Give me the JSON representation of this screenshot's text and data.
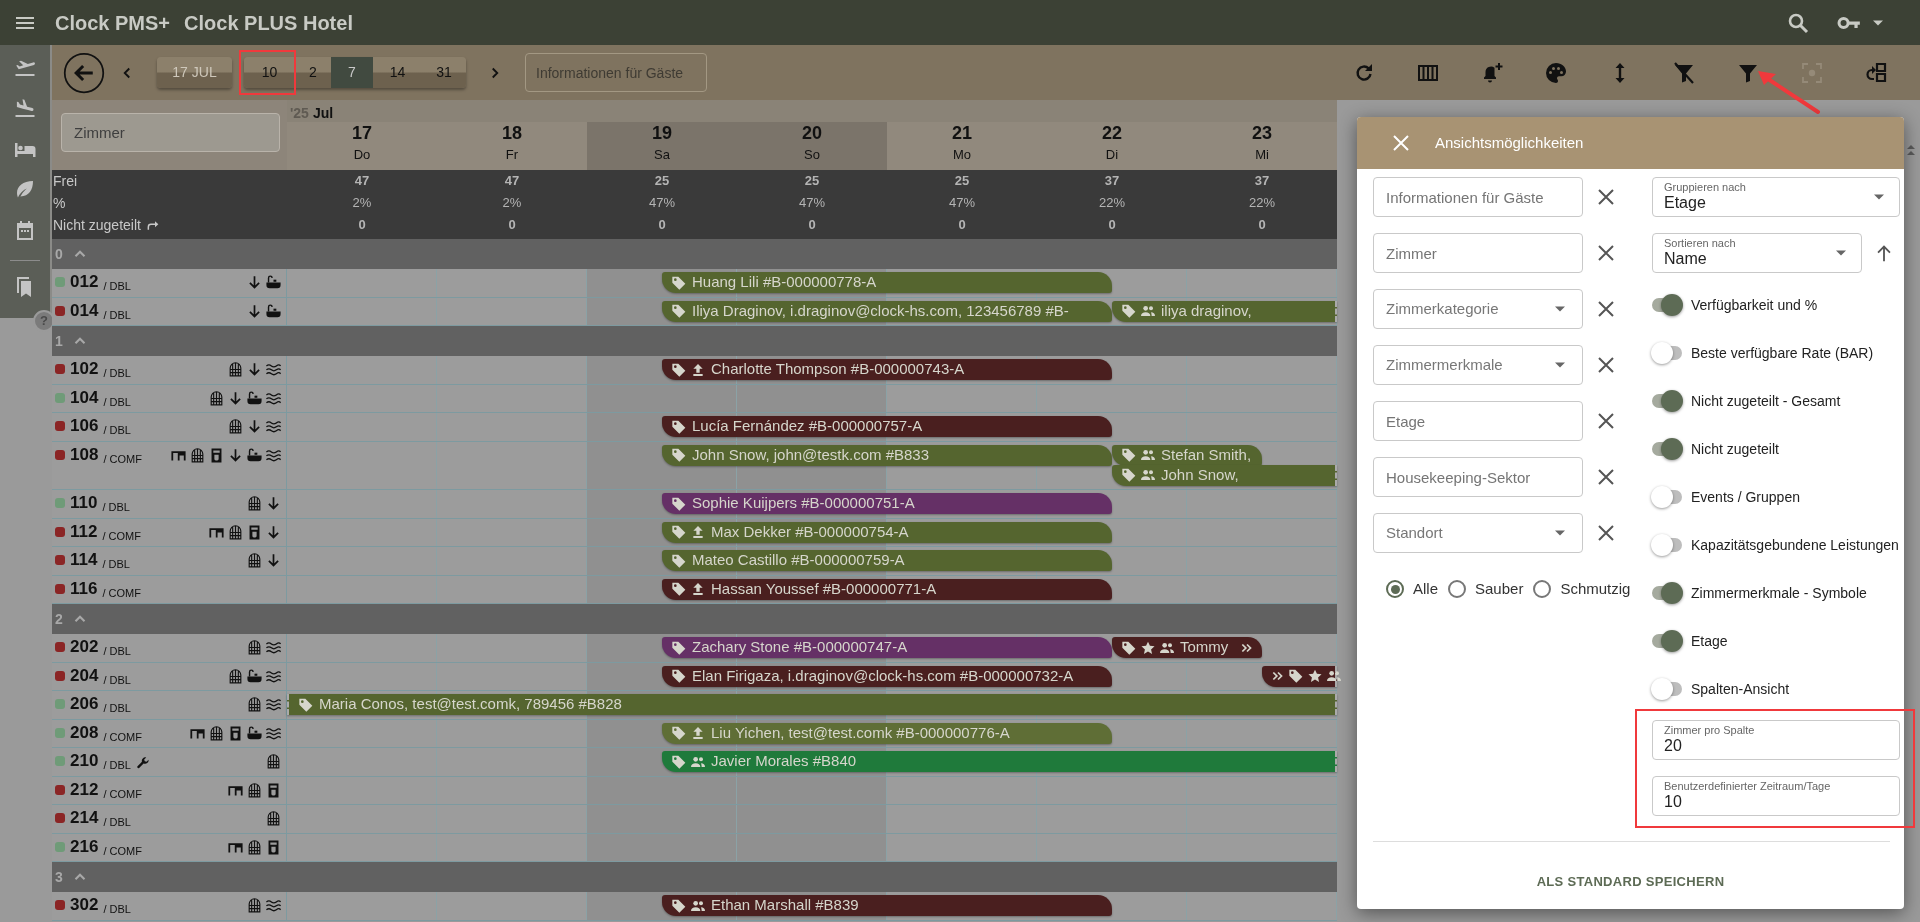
{
  "app_bar": {
    "brand": "Clock PMS+",
    "hotel": "Clock PLUS Hotel"
  },
  "sidebar": {
    "items": [
      {
        "kind": "departures"
      },
      {
        "kind": "arrivals"
      },
      {
        "kind": "rooms"
      },
      {
        "kind": "housekeeping"
      },
      {
        "kind": "calendar"
      },
      {
        "kind": "divider"
      },
      {
        "kind": "bookmarks"
      }
    ],
    "help": "?"
  },
  "toolbar": {
    "date_button": "17 JUL",
    "ranges": [
      {
        "label": "10",
        "selected": false,
        "highlighted": true
      },
      {
        "label": "2",
        "selected": false,
        "highlighted": false
      },
      {
        "label": "7",
        "selected": true,
        "highlighted": false
      },
      {
        "label": "14",
        "selected": false,
        "highlighted": false
      },
      {
        "label": "31",
        "selected": false,
        "highlighted": false
      }
    ],
    "search": {
      "placeholder": "Informationen für Gäste"
    },
    "actions": [
      {
        "kind": "refresh",
        "disabled": false,
        "pointed": false
      },
      {
        "kind": "columns",
        "disabled": false,
        "pointed": false
      },
      {
        "kind": "reminder",
        "disabled": false,
        "pointed": false
      },
      {
        "kind": "colors",
        "disabled": false,
        "pointed": false
      },
      {
        "kind": "row_height",
        "disabled": false,
        "pointed": false
      },
      {
        "kind": "clear_filter",
        "disabled": false,
        "pointed": false
      },
      {
        "kind": "filter",
        "disabled": false,
        "pointed": true
      },
      {
        "kind": "focus",
        "disabled": true,
        "pointed": false
      },
      {
        "kind": "layout",
        "disabled": false,
        "pointed": false
      }
    ]
  },
  "grid": {
    "room_filter": {
      "placeholder": "Zimmer"
    },
    "year": "'25",
    "month": "Jul",
    "days": [
      {
        "date": "17",
        "weekday": "Do",
        "weekend": false
      },
      {
        "date": "18",
        "weekday": "Fr",
        "weekend": false
      },
      {
        "date": "19",
        "weekday": "Sa",
        "weekend": true
      },
      {
        "date": "20",
        "weekday": "So",
        "weekend": true
      },
      {
        "date": "21",
        "weekday": "Mo",
        "weekend": false
      },
      {
        "date": "22",
        "weekday": "Di",
        "weekend": false
      },
      {
        "date": "23",
        "weekday": "Mi",
        "weekend": false
      }
    ],
    "stats": [
      {
        "kind": "count",
        "label": "Frei",
        "values": [
          "47",
          "47",
          "25",
          "25",
          "25",
          "37",
          "37"
        ]
      },
      {
        "kind": "percent",
        "label": "%",
        "values": [
          "2%",
          "2%",
          "47%",
          "47%",
          "47%",
          "22%",
          "22%"
        ]
      },
      {
        "kind": "unassigned",
        "label": "Nicht zugeteilt",
        "values": [
          "0",
          "0",
          "0",
          "0",
          "0",
          "0",
          "0"
        ]
      }
    ],
    "floors": [
      {
        "label": "0",
        "expanded": true,
        "rooms": [
          {
            "number": "012",
            "category": "/ DBL",
            "color": "#6f9b78",
            "maintenance": false,
            "features": [
              {
                "kind": "arrow_down"
              },
              {
                "kind": "bathtub"
              }
            ],
            "bookings": [
              {
                "guest": "Huang Lili #B-000000778-A",
                "color": "#55652f",
                "kind": "from_third_day_three_nights"
              }
            ]
          },
          {
            "number": "014",
            "category": "/ DBL",
            "color": "#8b2525",
            "maintenance": false,
            "features": [
              {
                "kind": "arrow_down"
              },
              {
                "kind": "bathtub"
              }
            ],
            "bookings": [
              {
                "guest": "Iliya Draginov, i.draginov@clock-hs.com, 123456789 #B-",
                "color": "#55652f",
                "kind": "from_third_day_three_nights"
              },
              {
                "guest": "iliya draginov,",
                "color": "#55652f",
                "kind": "from_sixth_day_open",
                "marks": [
                  {
                    "kind": "group"
                  }
                ]
              }
            ]
          }
        ]
      },
      {
        "label": "1",
        "expanded": true,
        "rooms": [
          {
            "number": "102",
            "category": "/ DBL",
            "color": "#8b2525",
            "maintenance": false,
            "features": [
              {
                "kind": "window"
              },
              {
                "kind": "arrow_down"
              },
              {
                "kind": "waves"
              }
            ],
            "bookings": [
              {
                "guest": "Charlotte Thompson #B-000000743-A",
                "color": "#4a1f1f",
                "kind": "from_third_day_three_nights",
                "marks": [
                  {
                    "kind": "upload"
                  }
                ]
              }
            ]
          },
          {
            "number": "104",
            "category": "/ DBL",
            "color": "#6f9b78",
            "maintenance": false,
            "features": [
              {
                "kind": "window"
              },
              {
                "kind": "arrow_down"
              },
              {
                "kind": "bathtub"
              },
              {
                "kind": "waves"
              }
            ]
          },
          {
            "number": "106",
            "category": "/ DBL",
            "color": "#8b2525",
            "maintenance": false,
            "features": [
              {
                "kind": "window"
              },
              {
                "kind": "arrow_down"
              },
              {
                "kind": "waves"
              }
            ],
            "bookings": [
              {
                "guest": "Lucía Fernández #B-000000757-A",
                "color": "#4a1f1f",
                "kind": "from_third_day_three_nights"
              }
            ]
          },
          {
            "number": "108",
            "category": "/ COMF",
            "color": "#8b2525",
            "maintenance": false,
            "features": [
              {
                "kind": "desk"
              },
              {
                "kind": "window"
              },
              {
                "kind": "coffee"
              },
              {
                "kind": "arrow_down"
              },
              {
                "kind": "bathtub"
              },
              {
                "kind": "waves"
              }
            ],
            "bookings": [
              {
                "guest": "John Snow, john@testk.com #B833",
                "color": "#55652f",
                "kind": "from_third_day_three_nights"
              },
              {
                "guest": "Stefan Smith,",
                "color": "#55652f",
                "kind": "from_sixth_day_one_night",
                "marks": [
                  {
                    "kind": "group"
                  }
                ]
              },
              {
                "guest": "John Snow,",
                "color": "#55652f",
                "kind": "from_sixth_day_open",
                "marks": [
                  {
                    "kind": "group"
                  }
                ]
              }
            ]
          },
          {
            "number": "110",
            "category": "/ DBL",
            "color": "#6f9b78",
            "maintenance": false,
            "features": [
              {
                "kind": "window"
              },
              {
                "kind": "arrow_down"
              }
            ],
            "bookings": [
              {
                "guest": "Sophie Kuijpers #B-000000751-A",
                "color": "#653066",
                "kind": "from_third_day_three_nights"
              }
            ]
          },
          {
            "number": "112",
            "category": "/ COMF",
            "color": "#8b2525",
            "maintenance": false,
            "features": [
              {
                "kind": "desk"
              },
              {
                "kind": "window"
              },
              {
                "kind": "coffee"
              },
              {
                "kind": "arrow_down"
              }
            ],
            "bookings": [
              {
                "guest": "Max Dekker #B-000000754-A",
                "color": "#55652f",
                "kind": "from_third_day_three_nights",
                "marks": [
                  {
                    "kind": "upload"
                  }
                ]
              }
            ]
          },
          {
            "number": "114",
            "category": "/ DBL",
            "color": "#8b2525",
            "maintenance": false,
            "features": [
              {
                "kind": "window"
              },
              {
                "kind": "arrow_down"
              }
            ],
            "bookings": [
              {
                "guest": "Mateo Castillo #B-000000759-A",
                "color": "#55652f",
                "kind": "from_third_day_three_nights"
              }
            ]
          },
          {
            "number": "116",
            "category": "/ COMF",
            "color": "#8b2525",
            "maintenance": false,
            "bookings": [
              {
                "guest": "Hassan Youssef #B-000000771-A",
                "color": "#4a1f1f",
                "kind": "from_third_day_three_nights",
                "marks": [
                  {
                    "kind": "upload"
                  }
                ]
              }
            ]
          }
        ]
      },
      {
        "label": "2",
        "expanded": true,
        "rooms": [
          {
            "number": "202",
            "category": "/ DBL",
            "color": "#8b2525",
            "maintenance": false,
            "features": [
              {
                "kind": "window"
              },
              {
                "kind": "waves"
              }
            ],
            "bookings": [
              {
                "guest": "Zachary Stone #B-000000747-A",
                "color": "#653066",
                "kind": "from_third_day_three_nights"
              },
              {
                "guest": "Tommy",
                "color": "#4a1f1f",
                "kind": "from_sixth_day_one_night",
                "marks": [
                  {
                    "kind": "star"
                  },
                  {
                    "kind": "group"
                  }
                ],
                "end_marks": [
                  {
                    "kind": "chevrons"
                  }
                ]
              }
            ]
          },
          {
            "number": "204",
            "category": "/ DBL",
            "color": "#8b2525",
            "maintenance": false,
            "features": [
              {
                "kind": "window"
              },
              {
                "kind": "bathtub"
              },
              {
                "kind": "waves"
              }
            ],
            "bookings": [
              {
                "guest": "Elan Firigaza, i.draginov@clock-hs.com #B-000000732-A",
                "color": "#4a1f1f",
                "kind": "from_third_day_three_nights"
              },
              {
                "color": "#4a1f1f",
                "kind": "from_seventh_day_open",
                "lead_marks": [
                  {
                    "kind": "chevrons"
                  }
                ],
                "marks": [
                  {
                    "kind": "star"
                  },
                  {
                    "kind": "group"
                  }
                ]
              }
            ]
          },
          {
            "number": "206",
            "category": "/ DBL",
            "color": "#6f9b78",
            "maintenance": false,
            "features": [
              {
                "kind": "window"
              },
              {
                "kind": "waves"
              }
            ],
            "bookings": [
              {
                "guest": "Maria Conos, test@test.comk, 789456 #B828",
                "color": "#55652f",
                "kind": "from_before_view_open"
              }
            ]
          },
          {
            "number": "208",
            "category": "/ COMF",
            "color": "#6f9b78",
            "maintenance": false,
            "features": [
              {
                "kind": "desk"
              },
              {
                "kind": "window"
              },
              {
                "kind": "coffee"
              },
              {
                "kind": "bathtub"
              },
              {
                "kind": "waves"
              }
            ],
            "bookings": [
              {
                "guest": "Liu Yichen, test@test.comk #B-000000776-A",
                "color": "#5f6e36",
                "kind": "from_third_day_three_nights",
                "marks": [
                  {
                    "kind": "upload"
                  }
                ]
              }
            ]
          },
          {
            "number": "210",
            "category": "/ DBL",
            "color": "#6f9b78",
            "maintenance": true,
            "features": [
              {
                "kind": "window"
              }
            ],
            "bookings": [
              {
                "guest": "Javier Morales #B840",
                "color": "#1f7a3b",
                "kind": "from_third_day_open",
                "marks": [
                  {
                    "kind": "group"
                  }
                ]
              }
            ]
          },
          {
            "number": "212",
            "category": "/ COMF",
            "color": "#8b2525",
            "maintenance": false,
            "features": [
              {
                "kind": "desk"
              },
              {
                "kind": "window"
              },
              {
                "kind": "coffee"
              }
            ]
          },
          {
            "number": "214",
            "category": "/ DBL",
            "color": "#8b2525",
            "maintenance": false,
            "features": [
              {
                "kind": "window"
              }
            ]
          },
          {
            "number": "216",
            "category": "/ COMF",
            "color": "#6f9b78",
            "maintenance": false,
            "features": [
              {
                "kind": "desk"
              },
              {
                "kind": "window"
              },
              {
                "kind": "coffee"
              }
            ]
          }
        ]
      },
      {
        "label": "3",
        "expanded": true,
        "rooms": [
          {
            "number": "302",
            "category": "/ DBL",
            "color": "#8b2525",
            "maintenance": false,
            "features": [
              {
                "kind": "window"
              },
              {
                "kind": "waves"
              }
            ],
            "bookings": [
              {
                "guest": "Ethan Marshall #B839",
                "color": "#4a1f1f",
                "kind": "from_third_day_three_nights",
                "marks": [
                  {
                    "kind": "group"
                  }
                ]
              }
            ]
          }
        ]
      }
    ]
  },
  "view_options": {
    "title": "Ansichtsmöglichkeiten",
    "filters": [
      {
        "kind": "text",
        "placeholder": "Informationen für Gäste"
      },
      {
        "kind": "text",
        "placeholder": "Zimmer"
      },
      {
        "kind": "select",
        "placeholder": "Zimmerkategorie"
      },
      {
        "kind": "select",
        "placeholder": "Zimmermerkmale"
      },
      {
        "kind": "text",
        "placeholder": "Etage"
      },
      {
        "kind": "text",
        "placeholder": "Housekeeping-Sektor"
      },
      {
        "kind": "select",
        "placeholder": "Standort"
      }
    ],
    "cleanliness": [
      {
        "label": "Alle",
        "selected": true
      },
      {
        "label": "Sauber",
        "selected": false
      },
      {
        "label": "Schmutzig",
        "selected": false
      }
    ],
    "group_by": {
      "label": "Gruppieren nach",
      "value": "Etage"
    },
    "sort_by": {
      "label": "Sortieren nach",
      "value": "Name"
    },
    "toggles": [
      {
        "label": "Verfügbarkeit und %",
        "on": true
      },
      {
        "label": "Beste verfügbare Rate (BAR)",
        "on": false
      },
      {
        "label": "Nicht zugeteilt - Gesamt",
        "on": true
      },
      {
        "label": "Nicht zugeteilt",
        "on": true
      },
      {
        "label": "Events / Gruppen",
        "on": false
      },
      {
        "label": "Kapazitätsgebundene Leistungen",
        "on": false
      },
      {
        "label": "Zimmermerkmale - Symbole",
        "on": true
      },
      {
        "label": "Etage",
        "on": true
      },
      {
        "label": "Spalten-Ansicht",
        "on": false
      }
    ],
    "settings": [
      {
        "label": "Zimmer pro Spalte",
        "value": "20"
      },
      {
        "label": "Benutzerdefinierter Zeitraum/Tage",
        "value": "10"
      }
    ],
    "settings_highlighted": true,
    "save_button": "ALS STANDARD SPEICHERN"
  }
}
